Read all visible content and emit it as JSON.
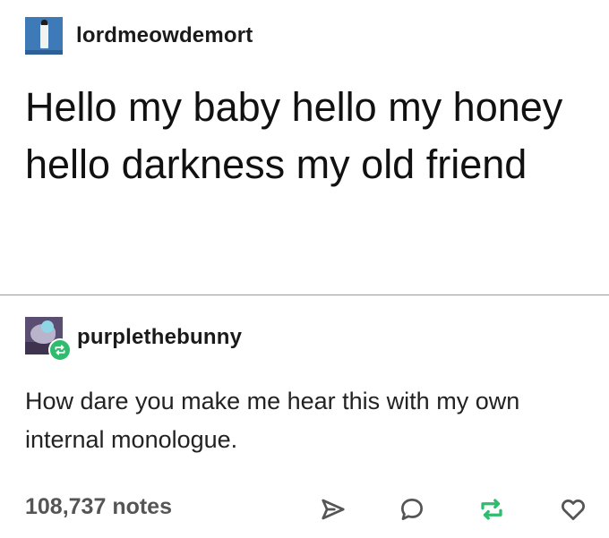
{
  "original_post": {
    "username": "lordmeowdemort",
    "avatar_icon": "cat-avatar-icon",
    "text": "Hello my baby hello my honey hello darkness my old friend"
  },
  "reblog": {
    "username": "purplethebunny",
    "avatar_icon": "bunny-avatar-icon",
    "badge_icon": "reblog-badge-icon",
    "text": "How dare you make me hear this with my own internal monologue."
  },
  "footer": {
    "notes": "108,737 notes",
    "actions": [
      {
        "icon": "share-icon"
      },
      {
        "icon": "reply-icon"
      },
      {
        "icon": "reblog-icon"
      },
      {
        "icon": "like-icon"
      }
    ]
  },
  "colors": {
    "reblog_green": "#2fbc6e",
    "icon_gray": "#555555",
    "divider": "#9a9a9a"
  }
}
